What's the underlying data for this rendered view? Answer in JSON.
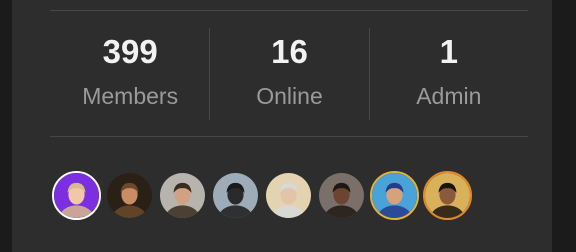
{
  "stats": [
    {
      "value": "399",
      "label": "Members"
    },
    {
      "value": "16",
      "label": "Online"
    },
    {
      "value": "1",
      "label": "Admin"
    }
  ],
  "avatars": [
    {
      "name": "member-avatar-1",
      "bg": "#7b2fe0",
      "ring": "#ffffff",
      "skin": "#f0c7a8",
      "hair": "#d8b98a"
    },
    {
      "name": "member-avatar-2",
      "bg": "#2a2016",
      "ring": "#2d2d2d",
      "skin": "#c98c64",
      "hair": "#6b4a2a"
    },
    {
      "name": "member-avatar-3",
      "bg": "#b7b3ad",
      "ring": "#2d2d2d",
      "skin": "#d1a184",
      "hair": "#3a2b20"
    },
    {
      "name": "member-avatar-4",
      "bg": "#9eabb9",
      "ring": "#2d2d2d",
      "skin": "#2a2a2a",
      "hair": "#1a1a1a"
    },
    {
      "name": "member-avatar-5",
      "bg": "#e3d3b0",
      "ring": "#2d2d2d",
      "skin": "#e2c4a8",
      "hair": "#d8d8d8"
    },
    {
      "name": "member-avatar-6",
      "bg": "#7a7069",
      "ring": "#2d2d2d",
      "skin": "#6b4530",
      "hair": "#1e1814"
    },
    {
      "name": "member-avatar-7",
      "bg": "#4aa3d8",
      "ring": "#e4b23a",
      "skin": "#d6a27a",
      "hair": "#243c8c"
    },
    {
      "name": "member-avatar-8",
      "bg": "#d9b15a",
      "ring": "#e08a2a",
      "skin": "#8a5a3a",
      "hair": "#1a1410"
    }
  ]
}
